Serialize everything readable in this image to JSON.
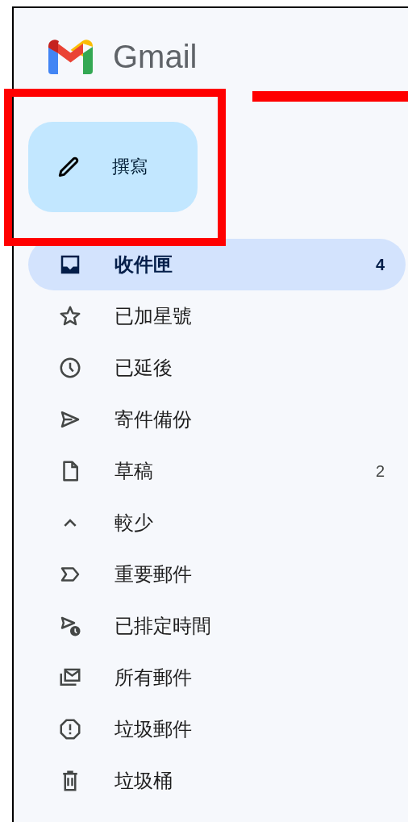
{
  "app": {
    "name": "Gmail"
  },
  "compose": {
    "label": "撰寫"
  },
  "nav": [
    {
      "kind": "inbox",
      "label": "收件匣",
      "count": "4",
      "selected": true
    },
    {
      "kind": "star",
      "label": "已加星號",
      "selected": false
    },
    {
      "kind": "clock",
      "label": "已延後",
      "selected": false
    },
    {
      "kind": "send",
      "label": "寄件備份",
      "selected": false
    },
    {
      "kind": "file",
      "label": "草稿",
      "count": "2",
      "selected": false
    },
    {
      "kind": "less",
      "label": "較少",
      "selected": false
    },
    {
      "kind": "important",
      "label": "重要郵件",
      "selected": false
    },
    {
      "kind": "scheduled",
      "label": "已排定時間",
      "selected": false
    },
    {
      "kind": "allmail",
      "label": "所有郵件",
      "selected": false
    },
    {
      "kind": "spam",
      "label": "垃圾郵件",
      "selected": false
    },
    {
      "kind": "trash",
      "label": "垃圾桶",
      "selected": false
    }
  ]
}
